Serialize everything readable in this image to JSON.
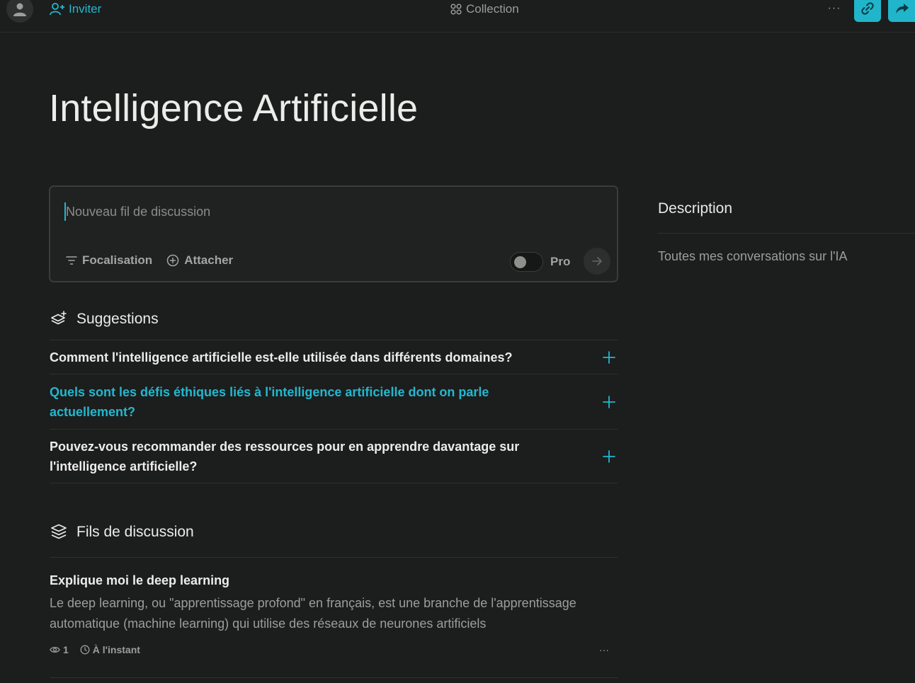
{
  "topbar": {
    "invite_label": "Inviter",
    "collection_label": "Collection",
    "more_label": "···"
  },
  "page": {
    "title": "Intelligence Artificielle"
  },
  "composer": {
    "placeholder": "Nouveau fil de discussion",
    "focus_label": "Focalisation",
    "attach_label": "Attacher",
    "pro_label": "Pro",
    "pro_enabled": false
  },
  "description": {
    "title": "Description",
    "text": "Toutes mes conversations sur l'IA"
  },
  "suggestions": {
    "heading": "Suggestions",
    "items": [
      {
        "text": "Comment l'intelligence artificielle est-elle utilisée dans différents domaines?"
      },
      {
        "text": "Quels sont les défis éthiques liés à l'intelligence artificielle dont on parle actuellement?"
      },
      {
        "text": "Pouvez-vous recommander des ressources pour en apprendre davantage sur l'intelligence artificielle?"
      }
    ]
  },
  "threads": {
    "heading": "Fils de discussion",
    "items": [
      {
        "title": "Explique moi le deep learning",
        "preview": "Le deep learning, ou \"apprentissage profond\" en français, est une branche de l'apprentissage automatique (machine learning) qui utilise des réseaux de neurones artificiels",
        "views": "1",
        "time": "À l'instant",
        "more_label": "···"
      }
    ]
  },
  "colors": {
    "accent": "#20b5cb",
    "background": "#1c1d1d",
    "text": "#ececea",
    "muted": "#9c9e9b"
  }
}
